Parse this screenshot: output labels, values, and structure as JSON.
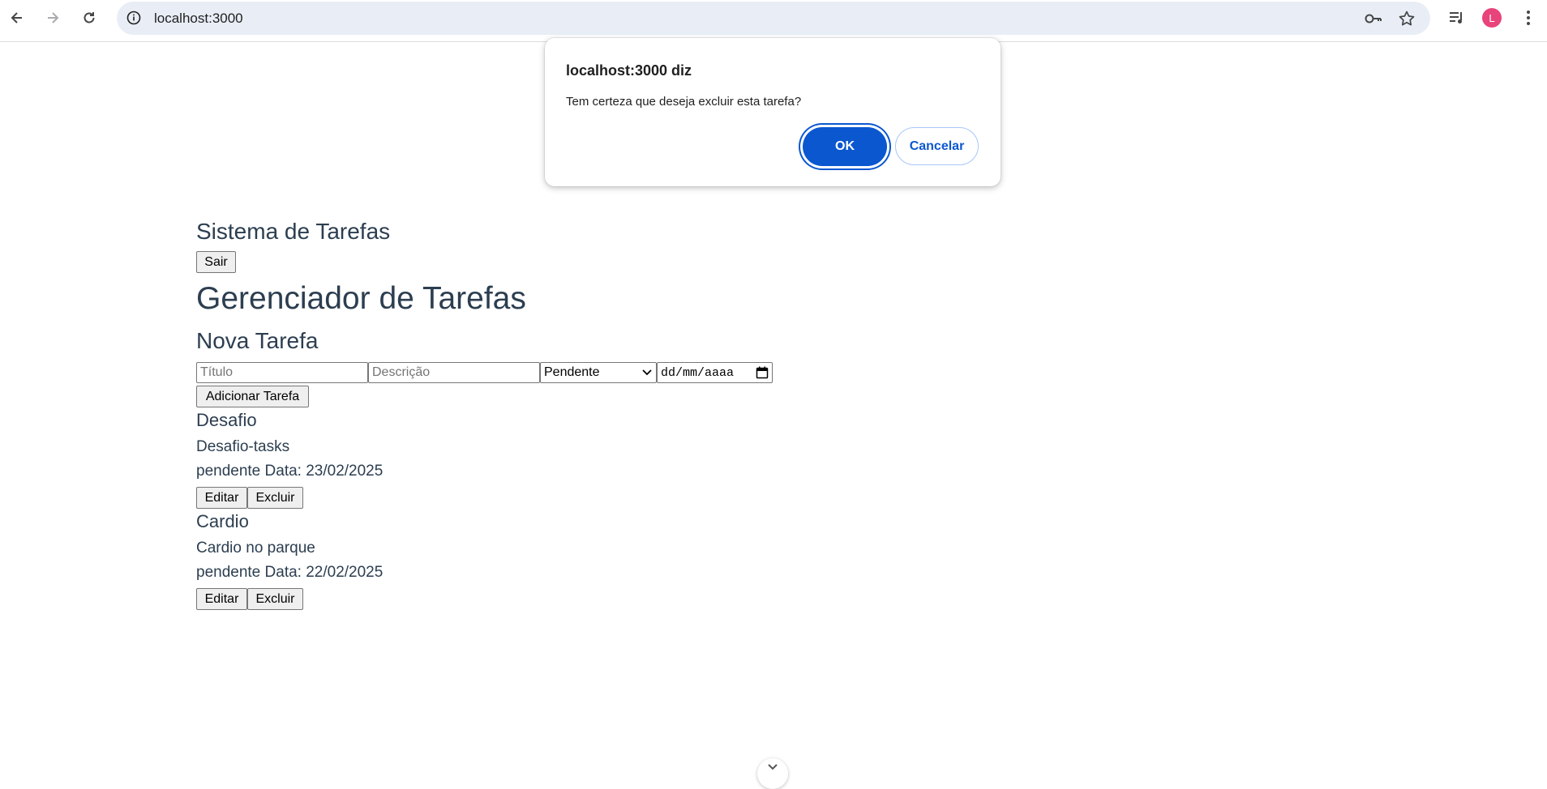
{
  "browser": {
    "url": "localhost:3000",
    "avatar_letter": "L"
  },
  "app": {
    "title": "Sistema de Tarefas",
    "logout_label": "Sair"
  },
  "main": {
    "title": "Gerenciador de Tarefas",
    "form": {
      "heading": "Nova Tarefa",
      "title_placeholder": "Título",
      "description_placeholder": "Descrição",
      "status_value": "Pendente",
      "date_placeholder": "dd/mm/aaaa",
      "submit_label": "Adicionar Tarefa"
    },
    "tasks": [
      {
        "title": "Desafio",
        "description": "Desafio-tasks",
        "meta": "pendente Data: 23/02/2025",
        "edit_label": "Editar",
        "delete_label": "Excluir"
      },
      {
        "title": "Cardio",
        "description": "Cardio no parque",
        "meta": "pendente Data: 22/02/2025",
        "edit_label": "Editar",
        "delete_label": "Excluir"
      }
    ]
  },
  "dialog": {
    "title": "localhost:3000 diz",
    "message": "Tem certeza que deseja excluir esta tarefa?",
    "ok_label": "OK",
    "cancel_label": "Cancelar"
  },
  "colors": {
    "text": "#2c3e50",
    "accent": "#0b57d0",
    "avatar": "#e8437a"
  }
}
